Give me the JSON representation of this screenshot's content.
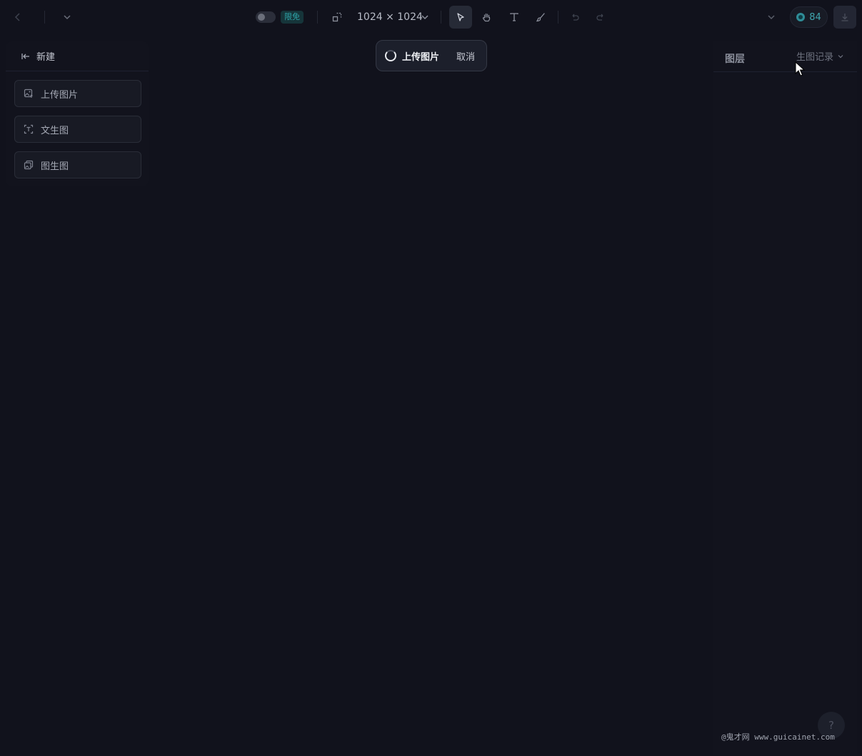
{
  "toolbar": {
    "free_badge": "限免",
    "size_label": "1024 × 1024",
    "points": "84"
  },
  "left_panel": {
    "header_label": "新建",
    "buttons": [
      {
        "label": "上传图片",
        "icon": "image-upload-icon"
      },
      {
        "label": "文生图",
        "icon": "text-to-image-icon"
      },
      {
        "label": "图生图",
        "icon": "image-to-image-icon"
      }
    ]
  },
  "toast": {
    "title": "上传图片",
    "cancel": "取消"
  },
  "right_panel": {
    "tab_layers": "图层",
    "tab_history": "生图记录"
  },
  "help": {
    "label": "?"
  },
  "watermark": "@鬼才网 www.guicainet.com",
  "colors": {
    "background": "#11121c",
    "panel": "#12131d",
    "accent_teal": "#2ea3a8"
  }
}
